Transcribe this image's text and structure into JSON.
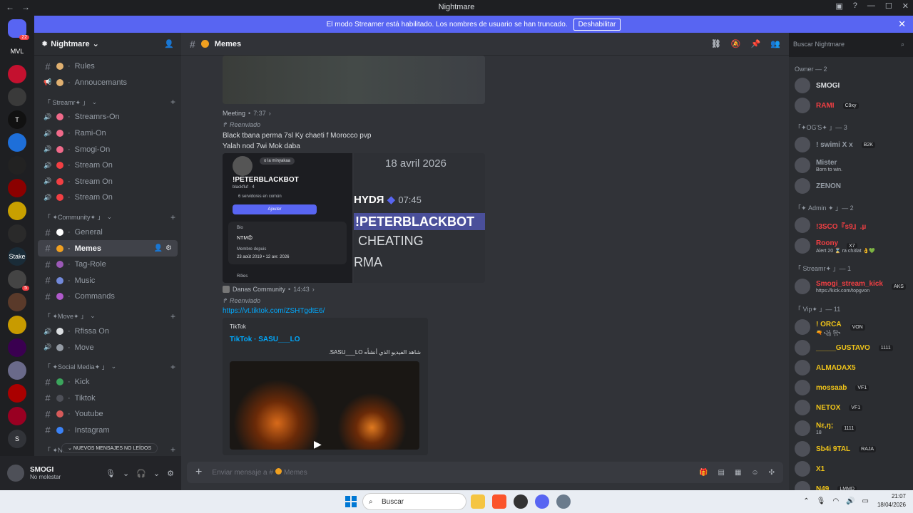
{
  "window": {
    "title": "Nightmare",
    "back": "←",
    "forward": "→"
  },
  "banner": {
    "text": "El modo Streamer está habilitado. Los nombres de usuario se han truncado.",
    "button": "Deshabilitar",
    "close": "✕"
  },
  "servers": [
    {
      "label": "",
      "badge": "22",
      "color": "#5865f2"
    },
    {
      "label": "MVL",
      "color": "#1e1f22"
    },
    {
      "label": "",
      "color": "#c4112f"
    },
    {
      "label": "",
      "color": "#3a3a3a"
    },
    {
      "label": "T",
      "color": "#111111"
    },
    {
      "label": "",
      "color": "#1e6fd9"
    },
    {
      "label": "",
      "color": "#222222"
    },
    {
      "label": "",
      "color": "#8b0000"
    },
    {
      "label": "",
      "color": "#c8a000"
    },
    {
      "label": "",
      "color": "#2a2a2a"
    },
    {
      "label": "Stake",
      "color": "#1a2c38"
    },
    {
      "label": "",
      "color": "#444444",
      "badge": "5"
    },
    {
      "label": "",
      "color": "#5a3a2a"
    },
    {
      "label": "",
      "color": "#c89b00"
    },
    {
      "label": "",
      "color": "#3a0050"
    },
    {
      "label": "",
      "color": "#6a6a8a"
    },
    {
      "label": "",
      "color": "#aa0000"
    },
    {
      "label": "",
      "color": "#990022"
    },
    {
      "label": "S",
      "color": "#313338"
    }
  ],
  "sidebar": {
    "server_name": "Nightmare",
    "channels_top": [
      {
        "icon": "#",
        "emoji": "#e0b070",
        "label": "Rules"
      },
      {
        "icon": "📢",
        "emoji": "#e0b070",
        "label": "Annoucemants"
      }
    ],
    "categories": [
      {
        "name": "「 Streamr✦ 」",
        "channels": [
          {
            "icon": "🔊",
            "emoji": "#f06a8a",
            "label": "Streamrs-On"
          },
          {
            "icon": "🔊",
            "emoji": "#f06a8a",
            "label": "Rami-On"
          },
          {
            "icon": "🔊",
            "emoji": "#f06a8a",
            "label": "Smogi-On"
          },
          {
            "icon": "🔊",
            "emoji": "#f23f43",
            "label": "Stream On"
          },
          {
            "icon": "🔊",
            "emoji": "#f23f43",
            "label": "Stream On"
          },
          {
            "icon": "🔊",
            "emoji": "#f23f43",
            "label": "Stream On"
          }
        ]
      },
      {
        "name": "「 ✦Community✦ 」",
        "channels": [
          {
            "icon": "#",
            "emoji": "#ffffff",
            "label": "General"
          },
          {
            "icon": "#",
            "emoji": "#f0a020",
            "label": "Memes",
            "active": true
          },
          {
            "icon": "#",
            "emoji": "#9b59b6",
            "label": "Tag-Role"
          },
          {
            "icon": "#",
            "emoji": "#7289da",
            "label": "Music"
          },
          {
            "icon": "#",
            "emoji": "#b05acb",
            "label": "Commands"
          }
        ]
      },
      {
        "name": "「 ✦Move✦ 」",
        "channels": [
          {
            "icon": "🔊",
            "emoji": "#dbdee1",
            "label": "Rfissa On"
          },
          {
            "icon": "🔊",
            "emoji": "#949ba4",
            "label": "Move"
          }
        ]
      },
      {
        "name": "「 ✦Social Media✦ 」",
        "channels": [
          {
            "icon": "#",
            "emoji": "#3ba55c",
            "label": "Kick"
          },
          {
            "icon": "#",
            "emoji": "#4e5058",
            "label": "Tiktok"
          },
          {
            "icon": "#",
            "emoji": "#d65a5a",
            "label": "Youtube"
          },
          {
            "icon": "#",
            "emoji": "#3b82f6",
            "label": "Instagram"
          }
        ]
      }
    ],
    "last_category": "「 ✦New✦ 」",
    "new_messages": "NUEVOS MENSAJES NO LEÍDOS"
  },
  "user": {
    "name": "SMOGI",
    "status": "No molestar"
  },
  "channel": {
    "name": "Memes",
    "search_placeholder": "Buscar Nightmare"
  },
  "messages": {
    "m1_meta_author": "Meeting",
    "m1_meta_time": "7:37",
    "m2_forwarded": "Reenviado",
    "m2_line1": "Black tbana perma 7sl Ky chaeti f Morocco pvp",
    "m2_line2": "Yalah nod 7wi Mok daba",
    "img_right": {
      "date": "18 avril 2026",
      "name": "HYDЯ",
      "time": "07:45",
      "bot": "!PETERBLACKBOT",
      "line3": "CHEATING",
      "line4": "RMA"
    },
    "img_left": {
      "bubble": "o la minyakaa",
      "title": "!PETERBLACKBOT",
      "sub": "blackfluf · 4",
      "servers": "6 servidores en común",
      "button": "Ajouter",
      "bio_label": "Bio",
      "bio": "NTM😍",
      "member_since": "Membre depuis",
      "date1": "23 août 2019",
      "date2": "12 avr. 2026",
      "roles": "Rôles"
    },
    "m2_meta_author": "Danas Community",
    "m2_meta_time": "14:43",
    "m3_forwarded": "Reenviado",
    "m3_link": "https://vt.tiktok.com/ZSHTgdtE6/",
    "embed_provider": "TikTok",
    "embed_title": "TikTok · SASU___LO",
    "embed_desc": "شاهد الفيديو الذي أنشأه SASU___LO."
  },
  "composer": {
    "placeholder": "Enviar mensaje a #",
    "channel": "Memes"
  },
  "members": {
    "groups": [
      {
        "title": "Owner — 2",
        "items": [
          {
            "name": "SMOGI",
            "color": "#dbdee1"
          },
          {
            "name": "RAMI",
            "color": "#f23f43",
            "tag": "C9xy"
          }
        ]
      },
      {
        "title": "「✦OG'S✦ 」— 3",
        "items": [
          {
            "name": "! swimi X x",
            "color": "#949ba4",
            "tag": "B2K"
          },
          {
            "name": "Mister",
            "color": "#949ba4",
            "sub": "Born to win."
          },
          {
            "name": "ZENON",
            "color": "#949ba4"
          }
        ]
      },
      {
        "title": "「✦ Admin ✦ 」— 2",
        "items": [
          {
            "name": "!3SCO『s9』.µ",
            "color": "#f23f43"
          },
          {
            "name": "Roony",
            "color": "#f23f43",
            "tag": "X7",
            "sub": "Alert 20 ⌛ ra ch3lat 👌💚"
          }
        ]
      },
      {
        "title": "「 Streamr✦ 」— 1",
        "items": [
          {
            "name": "Smogi_stream_kick",
            "color": "#f23f43",
            "tag": "AKS",
            "sub": "https://kick.com/topgvon"
          }
        ]
      },
      {
        "title": "「 Vip✦ 」— 11",
        "items": [
          {
            "name": "! ORCA",
            "color": "#f0c419",
            "tag": "VON",
            "sub": "🔫 ꧁ ꧂"
          },
          {
            "name": "_____GUSTAVO",
            "color": "#f0c419",
            "tag": "1111"
          },
          {
            "name": "ALMADAX5",
            "color": "#f0c419"
          },
          {
            "name": "mossaab",
            "color": "#f0c419",
            "tag": "VF1"
          },
          {
            "name": "NETOX",
            "color": "#f0c419",
            "tag": "VF1"
          },
          {
            "name": "Nε,ŋ;",
            "color": "#f0c419",
            "tag": "1111",
            "sub": "18"
          },
          {
            "name": "Sb4i 9TAL",
            "color": "#f0c419",
            "tag": "RAJA"
          },
          {
            "name": "X1",
            "color": "#f0c419"
          },
          {
            "name": "N49",
            "color": "#f0c419",
            "tag": "LMMD"
          }
        ]
      }
    ]
  },
  "taskbar": {
    "search": "Buscar",
    "time": "21:07",
    "date": "18/04/2026"
  }
}
